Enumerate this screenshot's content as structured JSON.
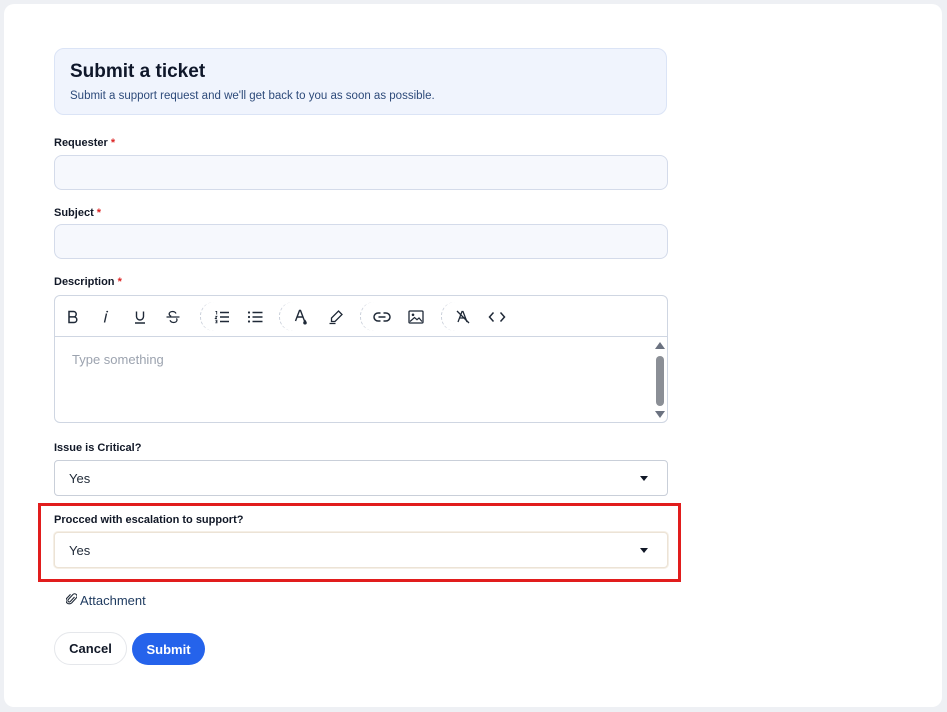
{
  "header": {
    "title": "Submit a ticket",
    "subtitle": "Submit a support request and we'll get back to you as soon as possible."
  },
  "fields": {
    "requester": {
      "label": "Requester",
      "required_mark": "*",
      "value": ""
    },
    "subject": {
      "label": "Subject",
      "required_mark": "*",
      "value": ""
    },
    "description": {
      "label": "Description",
      "required_mark": "*",
      "placeholder": "Type something",
      "toolbar": [
        "bold-icon",
        "italic-icon",
        "underline-icon",
        "strikethrough-icon",
        "ordered-list-icon",
        "bullet-list-icon",
        "text-color-icon",
        "highlight-icon",
        "link-icon",
        "image-icon",
        "clear-format-icon",
        "code-icon"
      ]
    },
    "critical": {
      "label": "Issue is Critical?",
      "value": "Yes"
    },
    "escalation": {
      "label": "Procced with escalation to support?",
      "value": "Yes"
    }
  },
  "attachment": {
    "label": "Attachment"
  },
  "actions": {
    "cancel": "Cancel",
    "submit": "Submit"
  },
  "colors": {
    "primary": "#2563eb",
    "required": "#dc2626",
    "highlight": "#e11d1d"
  }
}
